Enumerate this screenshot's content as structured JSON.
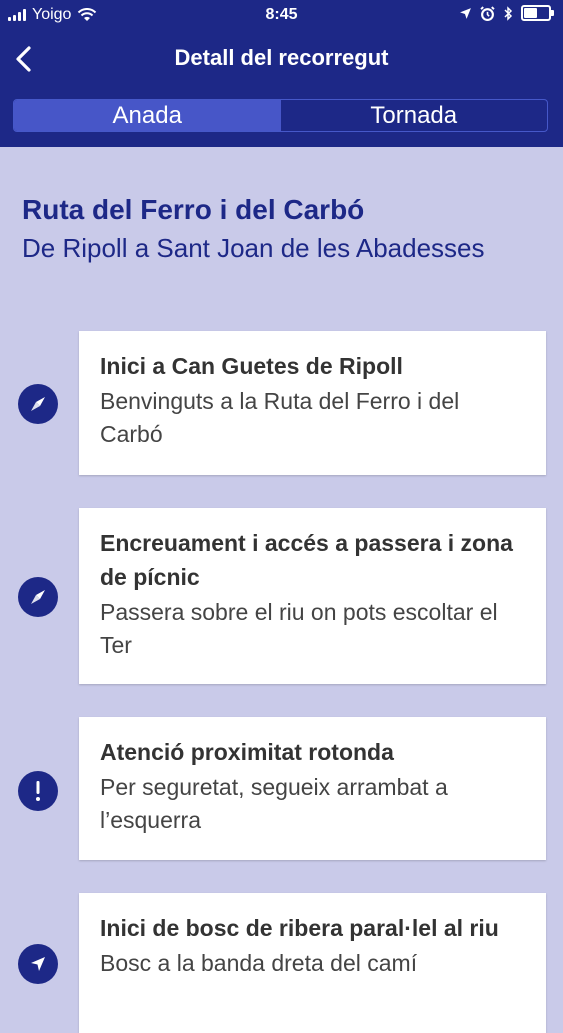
{
  "status_bar": {
    "carrier": "Yoigo",
    "time": "8:45",
    "battery_level": 0.6
  },
  "nav": {
    "title": "Detall del recorregut",
    "back_icon": "chevron-left-icon"
  },
  "tabs": [
    {
      "label": "Anada",
      "selected": true
    },
    {
      "label": "Tornada",
      "selected": false
    }
  ],
  "route": {
    "title": "Ruta del Ferro i del Carbó",
    "subtitle": "De Ripoll a Sant Joan de les Abadesses"
  },
  "steps": [
    {
      "icon": "compass-icon",
      "title": "Inici a Can Guetes de Ripoll",
      "description": "Benvinguts a la Ruta del Ferro i del Carbó"
    },
    {
      "icon": "compass-icon",
      "title": "Encreuament i accés a passera i zona de pícnic",
      "description": "Passera sobre el riu on pots escoltar el Ter"
    },
    {
      "icon": "exclamation-icon",
      "title": "Atenció proximitat rotonda",
      "description": "Per seguretat, segueix arrambat a l’esquerra"
    },
    {
      "icon": "navigation-arrow-icon",
      "title": "Inici de bosc de ribera paral·lel al riu",
      "description": "Bosc a la banda dreta del camí"
    }
  ],
  "colors": {
    "header_bg": "#1d2887",
    "page_bg": "#c9cae9",
    "accent": "#4756c8",
    "title_text": "#1d2887"
  }
}
